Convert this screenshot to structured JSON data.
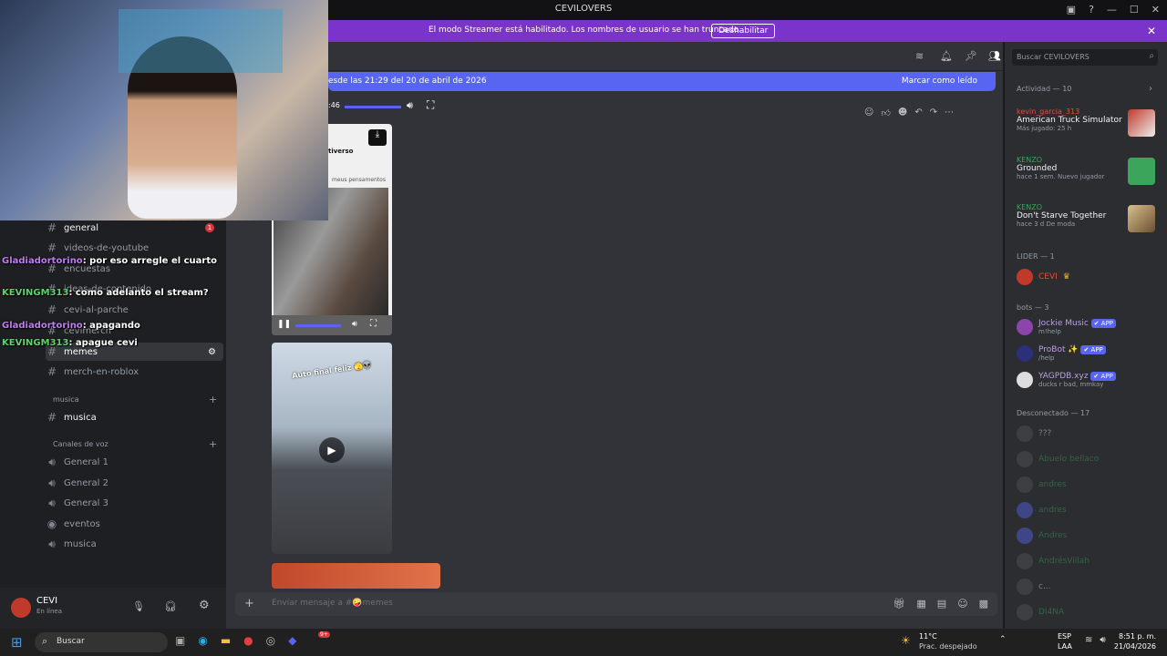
{
  "window": {
    "title": "CEVILOVERS"
  },
  "banner": {
    "message": "El modo Streamer está habilitado. Los nombres de usuario se han truncado.",
    "button": "Deshabilitar"
  },
  "header": {
    "search_placeholder": "Buscar CEVILOVERS"
  },
  "newbar": {
    "text": "esde las 21:29 del 20 de abril de 2026",
    "mark_read": "Marcar como leído"
  },
  "video1": {
    "time": ":46",
    "caption1": "tiverso",
    "caption2": "meus pensamentos"
  },
  "video2": {
    "caption": "Auto final feliz 🫣👽"
  },
  "sidebar": {
    "channels": [
      {
        "label": "general",
        "badge": "1"
      },
      {
        "label": "videos-de-youtube"
      },
      {
        "label": "encuestas"
      },
      {
        "label": "ideas-de-contenido"
      },
      {
        "label": "cevi-al-parche"
      },
      {
        "label": "cevimerch"
      },
      {
        "label": "memes"
      },
      {
        "label": "merch-en-roblox"
      }
    ],
    "cat_musica": "musica",
    "musica_channel": "musica",
    "cat_voice": "Canales de voz",
    "voice": [
      "General 1",
      "General 2",
      "General 3",
      "eventos",
      "musica"
    ]
  },
  "user": {
    "name": "CEVI",
    "status": "En línea"
  },
  "composer": {
    "placeholder": "Enviar mensaje a #🤪memes"
  },
  "members": {
    "activity_header": "Actividad — 10",
    "activities": [
      {
        "user": "kevin_garcia_313",
        "game": "American Truck Simulator",
        "sub": "Más jugado: 25 h",
        "user_color": "#e74c3c"
      },
      {
        "user": "KENZO",
        "game": "Grounded",
        "sub": "hace 1 sem.  Nuevo jugador",
        "user_color": "#3ba55c"
      },
      {
        "user": "KENZO",
        "game": "Don't Starve Together",
        "sub": "hace 3 d  De moda",
        "user_color": "#3ba55c"
      }
    ],
    "lider_header": "LIDER — 1",
    "lider": "CEVI",
    "bots_header": "bots — 3",
    "bots": [
      {
        "name": "Jockie Music",
        "sub": "m!help"
      },
      {
        "name": "ProBot ✨",
        "sub": "/help"
      },
      {
        "name": "YAGPDB.xyz",
        "sub": "ducks r bad, mmkay"
      }
    ],
    "app_badge": "✔ APP",
    "offline_header": "Desconectado — 17",
    "offline": [
      "???",
      "Abuelo bellaco",
      "andres",
      "andres",
      "Andres",
      "AndrésVillah",
      "c...",
      "DI4NA"
    ]
  },
  "chat_overlay": [
    {
      "user": "Gladiadortorino",
      "text": ": por eso arregle el cuarto"
    },
    {
      "user": "KEVINGM313",
      "text": ": como adelanto el stream?"
    },
    {
      "user": "Gladiadortorino",
      "text": ": apagando"
    },
    {
      "user": "KEVINGM313",
      "text": ": apague cevi"
    }
  ],
  "taskbar": {
    "search": "Buscar",
    "weather_temp": "11°C",
    "weather_desc": "Prac. despejado",
    "lang1": "ESP",
    "lang2": "LAA",
    "time": "8:51 p. m.",
    "date": "21/04/2026",
    "discord_badge": "9+"
  },
  "colors": {
    "accent": "#5865f2",
    "banner": "#7b34c9",
    "online": "#23a55a"
  }
}
